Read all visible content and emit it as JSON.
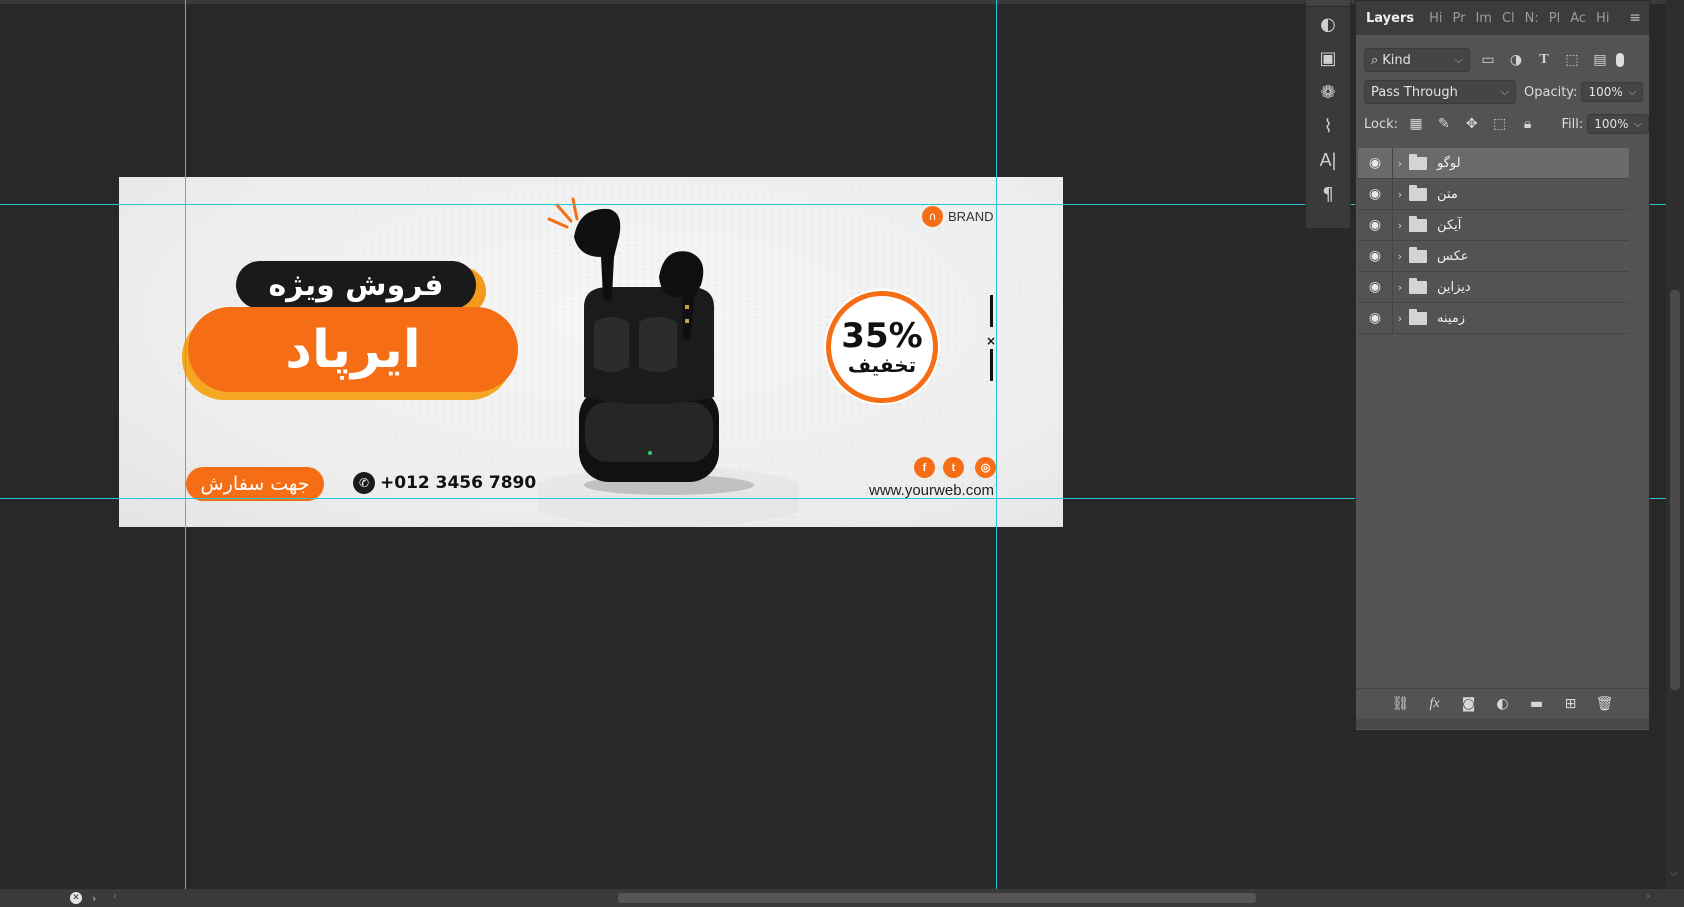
{
  "document": {
    "banner": {
      "title_small": "فروش ویژه",
      "title_main": "ایرپاد",
      "order_button": "جهت سفارش",
      "phone": "+012 3456 7890",
      "discount_percent": "35%",
      "discount_label": "تخفیف",
      "brand": "BRAND",
      "website": "www.yourweb.com",
      "social_icons": [
        "facebook-icon",
        "twitter-icon",
        "instagram-icon"
      ],
      "colors": {
        "accent": "#f56d14",
        "accent_secondary": "#f5a623",
        "dark": "#1a1a1a",
        "guides": "#29c6d6"
      }
    }
  },
  "tools": [
    "adjustments-icon",
    "properties-icon",
    "channels-icon",
    "paths-icon",
    "character-icon",
    "paragraph-icon"
  ],
  "layers_panel": {
    "tabs": [
      "Layers",
      "Hi",
      "Pr",
      "Im",
      "Cl",
      "N:",
      "Pl",
      "Ac",
      "Hi"
    ],
    "filter_kind": "Kind",
    "blend_mode": "Pass Through",
    "opacity_label": "Opacity:",
    "opacity_value": "100%",
    "lock_label": "Lock:",
    "fill_label": "Fill:",
    "fill_value": "100%",
    "layers": [
      {
        "name": "لوگو",
        "selected": true
      },
      {
        "name": "متن",
        "selected": false
      },
      {
        "name": "آیکن",
        "selected": false
      },
      {
        "name": "عکس",
        "selected": false
      },
      {
        "name": "دیزاین",
        "selected": false
      },
      {
        "name": "زمینه",
        "selected": false
      }
    ]
  }
}
